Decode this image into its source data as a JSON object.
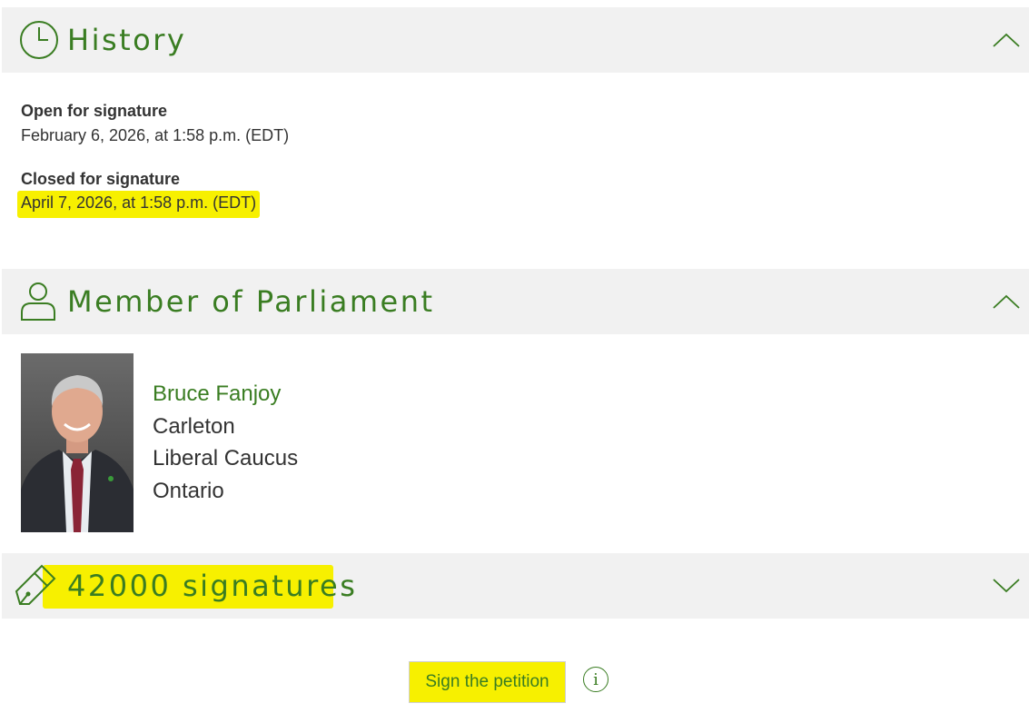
{
  "history": {
    "title": "History",
    "icon": "clock-icon",
    "open_label": "Open for signature",
    "open_value": "February 6, 2026, at 1:58 p.m. (EDT)",
    "closed_label": "Closed for signature",
    "closed_value": "April 7, 2026, at 1:58 p.m. (EDT)"
  },
  "member": {
    "title": "Member of Parliament",
    "icon": "person-icon",
    "name": "Bruce Fanjoy",
    "riding": "Carleton",
    "caucus": "Liberal Caucus",
    "province": "Ontario"
  },
  "signatures": {
    "title": "42000 signatures",
    "icon": "pen-nib-icon"
  },
  "actions": {
    "sign_label": "Sign the petition",
    "info_glyph": "i"
  },
  "colors": {
    "accent": "#3a7d22",
    "header_bg": "#f1f1f1",
    "highlight": "#f7f000"
  }
}
